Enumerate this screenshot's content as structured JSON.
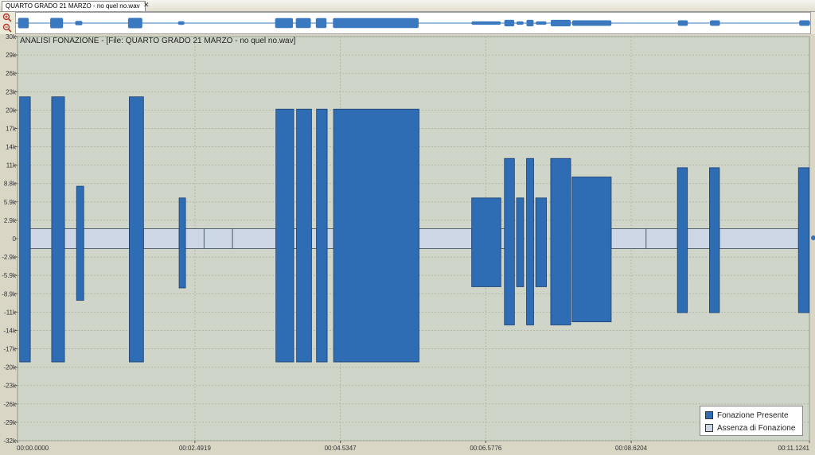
{
  "tab": {
    "label": "QUARTO GRADO 21  MARZO - no quel no.wav",
    "close": "✕"
  },
  "toolbar": {
    "zoom_in_icon": "zoom-in-icon",
    "zoom_out_icon": "zoom-out-icon"
  },
  "colors": {
    "present": "#2e6db4",
    "absent": "#cdd6e4",
    "plot_bg": "#cfd6c9",
    "grid": "#a9b3a3",
    "wave": "#3a78c0"
  },
  "chart_data": {
    "type": "bar",
    "title": "ANALISI FONAZIONE - [File: QUARTO GRADO 21 MARZO - no quel no.wav]",
    "xlabel": "",
    "ylabel": "",
    "y_tick_labels": [
      "30k",
      "29k",
      "26k",
      "23k",
      "20k",
      "17k",
      "14k",
      "11k",
      "8.8k",
      "5.9k",
      "2.9k",
      "0",
      "-2.9k",
      "-5.9k",
      "-8.9k",
      "-11k",
      "-14k",
      "-17k",
      "-20k",
      "-23k",
      "-26k",
      "-29k",
      "-32k"
    ],
    "y_tick_values": [
      30000,
      29000,
      26000,
      23000,
      20000,
      17000,
      14000,
      11000,
      8800,
      5900,
      2900,
      0,
      -2900,
      -5900,
      -8900,
      -11000,
      -14000,
      -17000,
      -20000,
      -23000,
      -26000,
      -29000,
      -32000
    ],
    "ylim": [
      -32768,
      32767
    ],
    "x_tick_labels": [
      "00:00.0000",
      "00:02.4919",
      "00:04.5347",
      "00:06.5776",
      "00:08.6204",
      "00:11.1241"
    ],
    "x_tick_values": [
      0.0,
      2.4919,
      4.5347,
      6.5776,
      8.6204,
      11.1241
    ],
    "xlim": [
      0.0,
      11.1241
    ],
    "grid": true,
    "legend_position": "bottom-right",
    "series": [
      {
        "name": "Fonazione Presente",
        "segments": [
          {
            "start": 0.03,
            "end": 0.18,
            "top": 23000,
            "bottom": -20000
          },
          {
            "start": 0.48,
            "end": 0.66,
            "top": 23000,
            "bottom": -20000
          },
          {
            "start": 0.83,
            "end": 0.93,
            "top": 8500,
            "bottom": -10000
          },
          {
            "start": 1.57,
            "end": 1.77,
            "top": 23000,
            "bottom": -20000
          },
          {
            "start": 2.27,
            "end": 2.36,
            "top": 6600,
            "bottom": -8000
          },
          {
            "start": 3.63,
            "end": 3.88,
            "top": 21000,
            "bottom": -20000
          },
          {
            "start": 3.92,
            "end": 4.13,
            "top": 21000,
            "bottom": -20000
          },
          {
            "start": 4.2,
            "end": 4.35,
            "top": 21000,
            "bottom": -20000
          },
          {
            "start": 4.44,
            "end": 5.64,
            "top": 21000,
            "bottom": -20000
          },
          {
            "start": 6.38,
            "end": 6.79,
            "top": 6600,
            "bottom": -7800
          },
          {
            "start": 6.84,
            "end": 6.98,
            "top": 13000,
            "bottom": -14000
          },
          {
            "start": 7.01,
            "end": 7.11,
            "top": 6600,
            "bottom": -7800
          },
          {
            "start": 7.15,
            "end": 7.25,
            "top": 13000,
            "bottom": -14000
          },
          {
            "start": 7.28,
            "end": 7.43,
            "top": 6600,
            "bottom": -7800
          },
          {
            "start": 7.49,
            "end": 7.77,
            "top": 13000,
            "bottom": -14000
          },
          {
            "start": 7.79,
            "end": 8.34,
            "top": 10000,
            "bottom": -13500
          },
          {
            "start": 9.27,
            "end": 9.41,
            "top": 11500,
            "bottom": -12000
          },
          {
            "start": 9.72,
            "end": 9.86,
            "top": 11500,
            "bottom": -12000
          },
          {
            "start": 10.97,
            "end": 11.12,
            "top": 11500,
            "bottom": -12000
          }
        ]
      },
      {
        "name": "Assenza di Fonazione",
        "segments": [
          {
            "start": 0.18,
            "end": 0.48,
            "top": 1600,
            "bottom": -1600
          },
          {
            "start": 0.66,
            "end": 0.83,
            "top": 1600,
            "bottom": -1600
          },
          {
            "start": 0.93,
            "end": 1.57,
            "top": 1600,
            "bottom": -1600
          },
          {
            "start": 1.77,
            "end": 2.27,
            "top": 1600,
            "bottom": -1600
          },
          {
            "start": 2.36,
            "end": 2.62,
            "top": 1600,
            "bottom": -1600
          },
          {
            "start": 2.62,
            "end": 3.02,
            "top": 1600,
            "bottom": -1600
          },
          {
            "start": 3.02,
            "end": 3.63,
            "top": 1600,
            "bottom": -1600
          },
          {
            "start": 3.88,
            "end": 3.92,
            "top": 1600,
            "bottom": -1600
          },
          {
            "start": 4.13,
            "end": 4.2,
            "top": 1600,
            "bottom": -1600
          },
          {
            "start": 4.35,
            "end": 4.44,
            "top": 1600,
            "bottom": -1600
          },
          {
            "start": 5.64,
            "end": 6.38,
            "top": 1600,
            "bottom": -1600
          },
          {
            "start": 6.79,
            "end": 6.84,
            "top": 1600,
            "bottom": -1600
          },
          {
            "start": 8.34,
            "end": 8.83,
            "top": 1600,
            "bottom": -1600
          },
          {
            "start": 8.83,
            "end": 9.27,
            "top": 1600,
            "bottom": -1600
          },
          {
            "start": 9.41,
            "end": 9.72,
            "top": 1600,
            "bottom": -1600
          },
          {
            "start": 9.86,
            "end": 10.97,
            "top": 1600,
            "bottom": -1600
          }
        ]
      }
    ]
  },
  "legend": {
    "present_label": "Fonazione Presente",
    "absent_label": "Assenza di Fonazione"
  }
}
